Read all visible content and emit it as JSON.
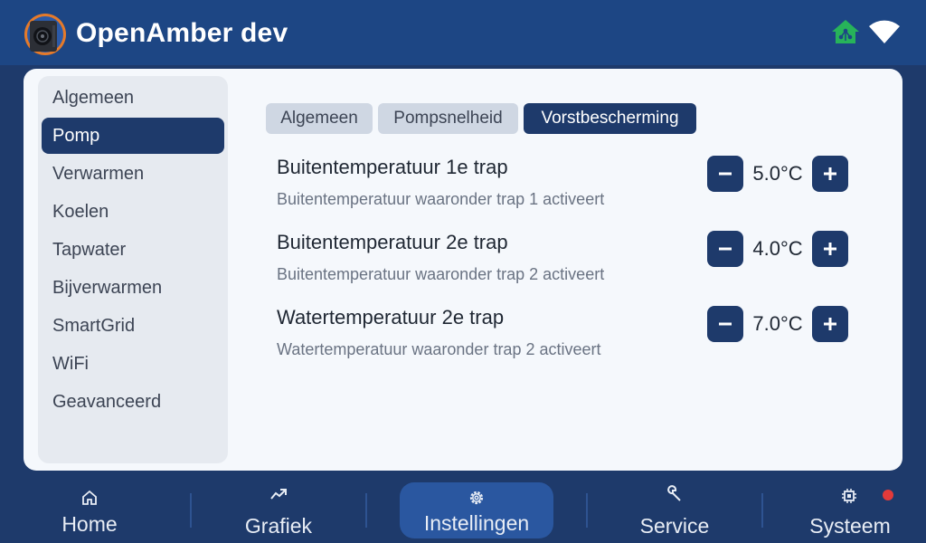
{
  "header": {
    "title": "OpenAmber dev",
    "logo_icon": "heat-pump-logo",
    "status_icons": [
      "home-network-icon",
      "wifi-icon"
    ],
    "accent_green": "#27b35a"
  },
  "sidebar": {
    "items": [
      {
        "label": "Algemeen",
        "active": false
      },
      {
        "label": "Pomp",
        "active": true
      },
      {
        "label": "Verwarmen",
        "active": false
      },
      {
        "label": "Koelen",
        "active": false
      },
      {
        "label": "Tapwater",
        "active": false
      },
      {
        "label": "Bijverwarmen",
        "active": false
      },
      {
        "label": "SmartGrid",
        "active": false
      },
      {
        "label": "WiFi",
        "active": false
      },
      {
        "label": "Geavanceerd",
        "active": false
      }
    ]
  },
  "tabs": [
    {
      "label": "Algemeen",
      "active": false
    },
    {
      "label": "Pompsnelheid",
      "active": false
    },
    {
      "label": "Vorstbescherming",
      "active": true
    }
  ],
  "settings": [
    {
      "title": "Buitentemperatuur 1e trap",
      "description": "Buitentemperatuur waaronder trap 1 activeert",
      "value": "5.0°C"
    },
    {
      "title": "Buitentemperatuur 2e trap",
      "description": "Buitentemperatuur waaronder trap 2 activeert",
      "value": "4.0°C"
    },
    {
      "title": "Watertemperatuur 2e trap",
      "description": "Watertemperatuur waaronder trap 2 activeert",
      "value": "7.0°C"
    }
  ],
  "stepper": {
    "minus_icon": "minus-icon",
    "plus_icon": "plus-icon"
  },
  "nav": {
    "items": [
      {
        "label": "Home",
        "icon": "home-icon",
        "active": false
      },
      {
        "label": "Grafiek",
        "icon": "chart-icon",
        "active": false
      },
      {
        "label": "Instellingen",
        "icon": "gear-icon",
        "active": true
      },
      {
        "label": "Service",
        "icon": "wrench-icon",
        "active": false
      },
      {
        "label": "Systeem",
        "icon": "chip-icon",
        "active": false
      }
    ],
    "alert_color": "#e33a3a"
  }
}
